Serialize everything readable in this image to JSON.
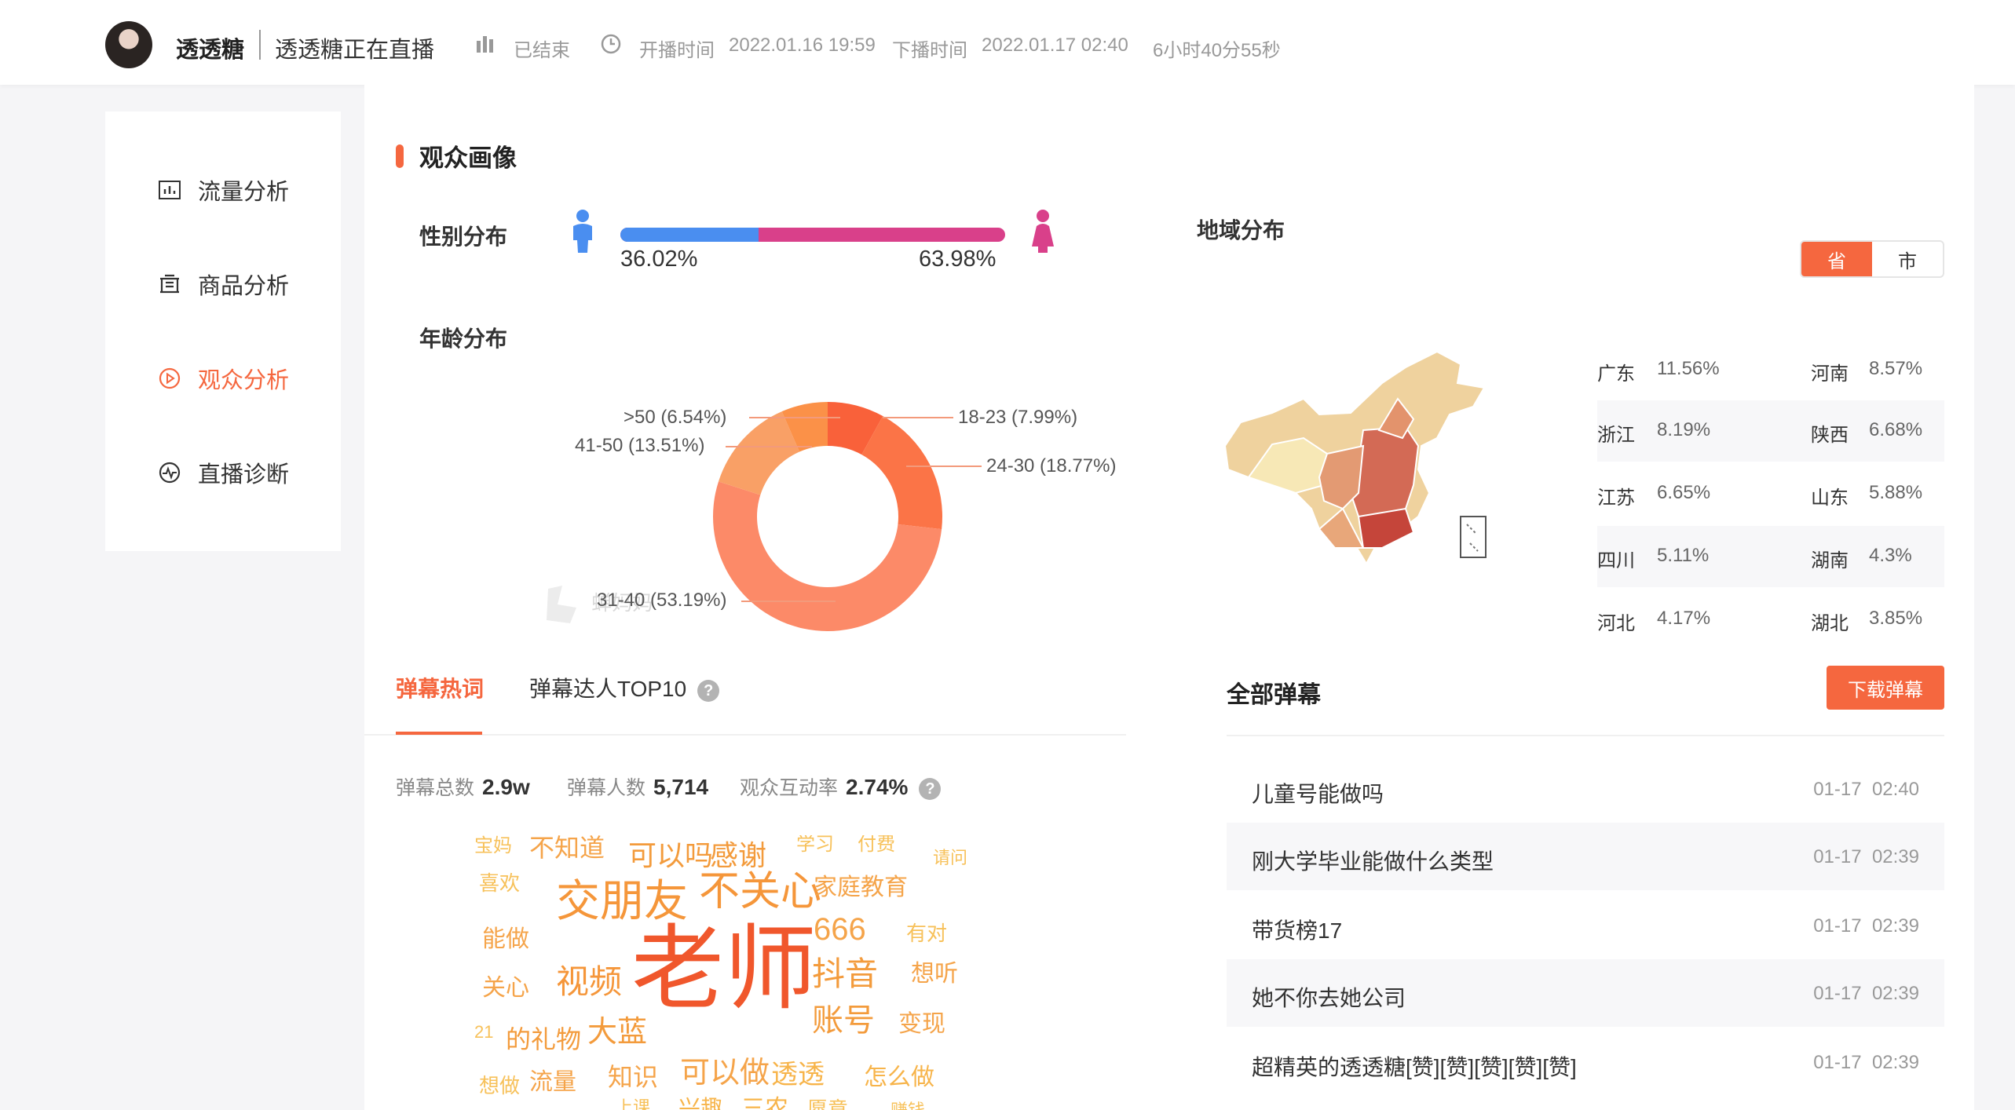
{
  "header": {
    "name": "透透糖",
    "title": "透透糖正在直播",
    "status": "已结束",
    "start_label": "开播时间",
    "start_time": "2022.01.16 19:59",
    "end_label": "下播时间",
    "end_time": "2022.01.17 02:40",
    "duration": "6小时40分55秒"
  },
  "sidebar": {
    "items": [
      {
        "label": "流量分析",
        "icon": "bar-chart-icon"
      },
      {
        "label": "商品分析",
        "icon": "goods-icon"
      },
      {
        "label": "观众分析",
        "icon": "play-circle-icon",
        "active": true
      },
      {
        "label": "直播诊断",
        "icon": "pulse-icon"
      }
    ]
  },
  "audience": {
    "section_title": "观众画像",
    "gender": {
      "label": "性别分布",
      "male_pct": "36.02%",
      "female_pct": "63.98%",
      "male_fraction": 0.3602
    },
    "age": {
      "label": "年龄分布"
    },
    "watermark": "蝉妈妈"
  },
  "chart_data": {
    "type": "pie",
    "labels": [
      "18-23",
      "24-30",
      "31-40",
      "41-50",
      ">50"
    ],
    "values": [
      7.99,
      18.77,
      53.19,
      13.51,
      6.54
    ],
    "display_labels": [
      "18-23 (7.99%)",
      "24-30 (18.77%)",
      "31-40 (53.19%)",
      "41-50 (13.51%)",
      ">50 (6.54%)"
    ],
    "colors": [
      "#f9613a",
      "#fb7447",
      "#fc8a68",
      "#f9a066",
      "#fb9148"
    ]
  },
  "region": {
    "title": "地域分布",
    "toggle": [
      "省",
      "市"
    ],
    "rows": [
      [
        {
          "name": "广东",
          "value": "11.56%"
        },
        {
          "name": "河南",
          "value": "8.57%"
        }
      ],
      [
        {
          "name": "浙江",
          "value": "8.19%"
        },
        {
          "name": "陕西",
          "value": "6.68%"
        }
      ],
      [
        {
          "name": "江苏",
          "value": "6.65%"
        },
        {
          "name": "山东",
          "value": "5.88%"
        }
      ],
      [
        {
          "name": "四川",
          "value": "5.11%"
        },
        {
          "name": "湖南",
          "value": "4.3%"
        }
      ],
      [
        {
          "name": "河北",
          "value": "4.17%"
        },
        {
          "name": "湖北",
          "value": "3.85%"
        }
      ]
    ]
  },
  "tabs": [
    {
      "label": "弹幕热词",
      "active": true
    },
    {
      "label": "弹幕达人TOP10"
    }
  ],
  "stats": [
    {
      "label": "弹幕总数",
      "value": "2.9w"
    },
    {
      "label": "弹幕人数",
      "value": "5,714"
    },
    {
      "label": "观众互动率",
      "value": "2.74%"
    }
  ],
  "wordcloud": [
    "宝妈",
    "不知道",
    "可以吗",
    "感谢",
    "学习",
    "付费",
    "请问",
    "喜欢",
    "交朋友",
    "不关心",
    "家庭教育",
    "666",
    "有对",
    "能做",
    "关心",
    "视频",
    "老师",
    "抖音",
    "想听",
    "账号",
    "变现",
    "21",
    "的礼物",
    "大蓝",
    "想做",
    "流量",
    "知识",
    "可以做",
    "透透",
    "怎么做",
    "上课",
    "兴趣",
    "三农",
    "愿意",
    "赚钱"
  ],
  "danmaku": {
    "title": "全部弹幕",
    "download_label": "下载弹幕",
    "rows": [
      {
        "text": "儿童号能做吗",
        "date": "01-17",
        "time": "02:40"
      },
      {
        "text": "刚大学毕业能做什么类型",
        "date": "01-17",
        "time": "02:39"
      },
      {
        "text": "带货榜17",
        "date": "01-17",
        "time": "02:39"
      },
      {
        "text": "她不你去她公司",
        "date": "01-17",
        "time": "02:39"
      },
      {
        "text": "超精英的透透糖[赞][赞][赞][赞][赞]",
        "date": "01-17",
        "time": "02:39"
      }
    ]
  },
  "help_symbol": "?"
}
